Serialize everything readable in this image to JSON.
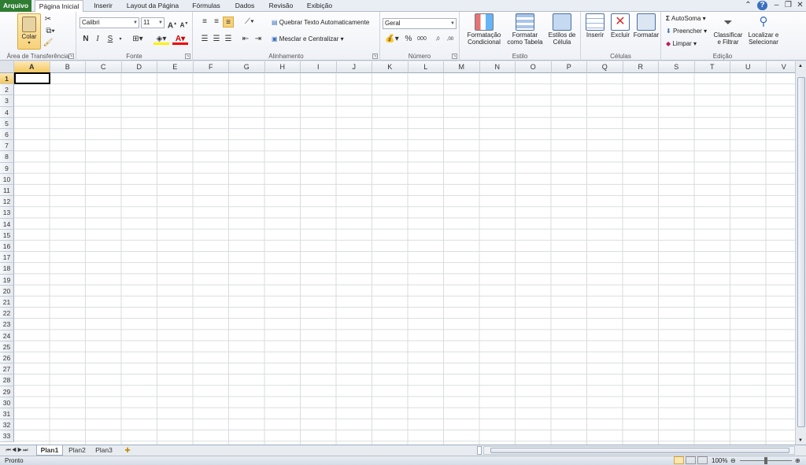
{
  "tabs": {
    "arquivo": "Arquivo",
    "home": "Página Inicial",
    "inserir": "Inserir",
    "layout": "Layout da Página",
    "formulas": "Fórmulas",
    "dados": "Dados",
    "revisao": "Revisão",
    "exibicao": "Exibição"
  },
  "clipboard": {
    "paste": "Colar",
    "label": "Área de Transferência"
  },
  "font": {
    "name": "Calibri",
    "size": "11",
    "bold": "N",
    "italic": "I",
    "underline": "S",
    "label": "Fonte"
  },
  "alignment": {
    "wrap": "Quebrar Texto Automaticamente",
    "merge": "Mesclar e Centralizar",
    "label": "Alinhamento"
  },
  "number": {
    "format": "Geral",
    "percent": "%",
    "thousands": "000",
    "inc": ",0→,00",
    "dec": ",00→,0",
    "label": "Número"
  },
  "styles": {
    "conditional": "Formatação Condicional",
    "table": "Formatar como Tabela",
    "cellstyles": "Estilos de Célula",
    "label": "Estilo"
  },
  "cells": {
    "insert": "Inserir",
    "delete": "Excluir",
    "format": "Formatar",
    "label": "Células"
  },
  "editing": {
    "autosum": "AutoSoma",
    "fill": "Preencher",
    "clear": "Limpar",
    "sort": "Classificar e Filtrar",
    "find": "Localizar e Selecionar",
    "label": "Edição"
  },
  "columns": [
    "A",
    "B",
    "C",
    "D",
    "E",
    "F",
    "G",
    "H",
    "I",
    "J",
    "K",
    "L",
    "M",
    "N",
    "O",
    "P",
    "Q",
    "R",
    "S",
    "T",
    "U",
    "V"
  ],
  "rows": [
    "1",
    "2",
    "3",
    "4",
    "5",
    "6",
    "7",
    "8",
    "9",
    "10",
    "11",
    "12",
    "13",
    "14",
    "15",
    "16",
    "17",
    "18",
    "19",
    "20",
    "21",
    "22",
    "23",
    "24",
    "25",
    "26",
    "27",
    "28",
    "29",
    "30",
    "31",
    "32",
    "33"
  ],
  "sheets": [
    "Plan1",
    "Plan2",
    "Plan3"
  ],
  "status": {
    "ready": "Pronto",
    "zoom": "100%"
  },
  "colors": {
    "arquivo": "#2e7d32",
    "selected_header": "#f5c860"
  }
}
